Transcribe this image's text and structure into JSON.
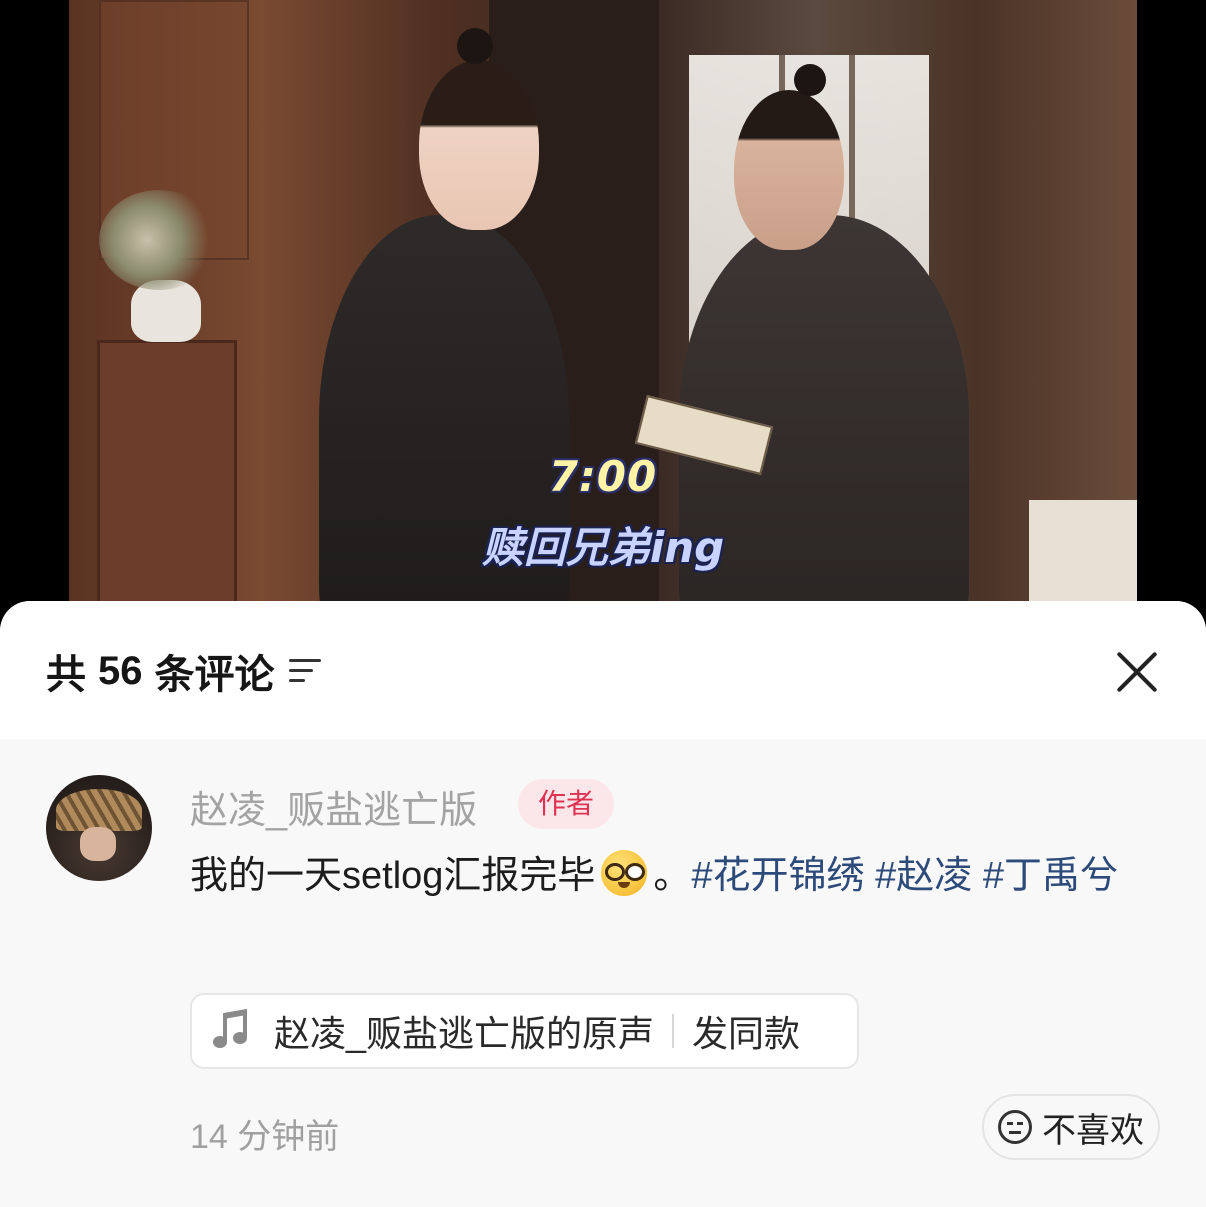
{
  "video": {
    "overlay_time": "7:00",
    "overlay_caption": "赎回兄弟ing"
  },
  "comments_panel": {
    "title_prefix": "共",
    "count": "56",
    "title_suffix": "条评论",
    "sort_icon": "sort-lines-icon",
    "close_icon": "close-icon"
  },
  "comment": {
    "username": "赵凌_贩盐逃亡版",
    "badge": "作者",
    "text_before_emoji": "我的一天setlog汇报完毕",
    "emoji": "nerd-face",
    "text_after_emoji": "。",
    "hashtags": [
      "#花开锦绣",
      "#赵凌",
      "#丁禹兮"
    ],
    "sound": {
      "icon": "music-note-icon",
      "title": "赵凌_贩盐逃亡版的原声",
      "action": "发同款"
    },
    "timestamp": "14 分钟前",
    "dislike": {
      "icon": "meh-face-icon",
      "label": "不喜欢"
    }
  }
}
